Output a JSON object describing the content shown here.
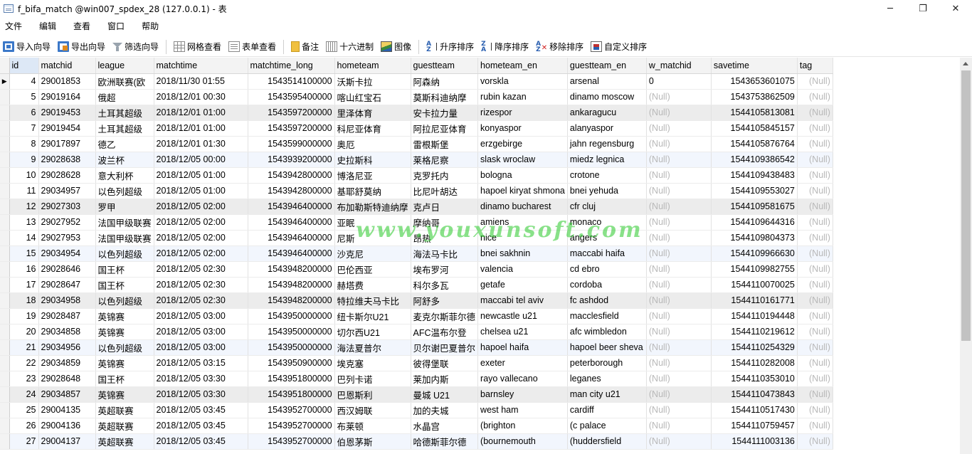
{
  "window": {
    "title": "f_bifa_match @win007_spdex_28 (127.0.0.1) - 表",
    "minimize": "─",
    "restore": "❐",
    "close": "✕"
  },
  "menu": [
    "文件",
    "编辑",
    "查看",
    "窗口",
    "帮助"
  ],
  "toolbar": {
    "import": "导入向导",
    "export": "导出向导",
    "filter": "筛选向导",
    "grid_view": "网格查看",
    "form_view": "表单查看",
    "memo": "备注",
    "hex": "十六进制",
    "image": "图像",
    "sort_asc": "升序排序",
    "sort_desc": "降序排序",
    "remove_sort": "移除排序",
    "custom_sort": "自定义排序"
  },
  "grid": {
    "columns": [
      "id",
      "matchid",
      "league",
      "matchtime",
      "matchtime_long",
      "hometeam",
      "guestteam",
      "hometeam_en",
      "guestteam_en",
      "w_matchid",
      "savetime",
      "tag"
    ],
    "null_text": "(Null)",
    "rows": [
      [
        "4",
        "29001853",
        "欧洲联赛(欧",
        "2018/11/30 01:55",
        "1543514100000",
        "沃斯卡拉",
        "阿森纳",
        "vorskla",
        "arsenal",
        "0",
        "1543653601075",
        "(Null)"
      ],
      [
        "5",
        "29019164",
        "俄超",
        "2018/12/01 00:30",
        "1543595400000",
        "喀山红宝石",
        "莫斯科迪纳摩",
        "rubin kazan",
        "dinamo moscow",
        "(Null)",
        "1543753862509",
        "(Null)"
      ],
      [
        "6",
        "29019453",
        "土耳其超级",
        "2018/12/01 01:00",
        "1543597200000",
        "里泽体育",
        "安卡拉力量",
        "rizespor",
        "ankaragucu",
        "(Null)",
        "1544105813081",
        "(Null)"
      ],
      [
        "7",
        "29019454",
        "土耳其超级",
        "2018/12/01 01:00",
        "1543597200000",
        "科尼亚体育",
        "阿拉尼亚体育",
        "konyaspor",
        "alanyaspor",
        "(Null)",
        "1544105845157",
        "(Null)"
      ],
      [
        "8",
        "29017897",
        "德乙",
        "2018/12/01 01:30",
        "1543599000000",
        "奥厄",
        "雷根斯堡",
        "erzgebirge",
        "jahn regensburg",
        "(Null)",
        "1544105876764",
        "(Null)"
      ],
      [
        "9",
        "29028638",
        "波兰杯",
        "2018/12/05 00:00",
        "1543939200000",
        "史拉斯科",
        "莱格尼察",
        "slask wroclaw",
        "miedz legnica",
        "(Null)",
        "1544109386542",
        "(Null)"
      ],
      [
        "10",
        "29028628",
        "意大利杯",
        "2018/12/05 01:00",
        "1543942800000",
        "博洛尼亚",
        "克罗托内",
        "bologna",
        "crotone",
        "(Null)",
        "1544109438483",
        "(Null)"
      ],
      [
        "11",
        "29034957",
        "以色列超级",
        "2018/12/05 01:00",
        "1543942800000",
        "基耶舒莫纳",
        "比尼叶胡达",
        "hapoel kiryat shmona",
        "bnei yehuda",
        "(Null)",
        "1544109553027",
        "(Null)"
      ],
      [
        "12",
        "29027303",
        "罗甲",
        "2018/12/05 02:00",
        "1543946400000",
        "布加勒斯特迪纳摩",
        "克卢日",
        "dinamo bucharest",
        "cfr cluj",
        "(Null)",
        "1544109581675",
        "(Null)"
      ],
      [
        "13",
        "29027952",
        "法国甲级联赛",
        "2018/12/05 02:00",
        "1543946400000",
        "亚眠",
        "摩纳哥",
        "amiens",
        "monaco",
        "(Null)",
        "1544109644316",
        "(Null)"
      ],
      [
        "14",
        "29027953",
        "法国甲级联赛",
        "2018/12/05 02:00",
        "1543946400000",
        "尼斯",
        "昂热",
        "nice",
        "angers",
        "(Null)",
        "1544109804373",
        "(Null)"
      ],
      [
        "15",
        "29034954",
        "以色列超级",
        "2018/12/05 02:00",
        "1543946400000",
        "沙克尼",
        "海法马卡比",
        "bnei sakhnin",
        "maccabi haifa",
        "(Null)",
        "1544109966630",
        "(Null)"
      ],
      [
        "16",
        "29028646",
        "国王杯",
        "2018/12/05 02:30",
        "1543948200000",
        "巴伦西亚",
        "埃布罗河",
        "valencia",
        "cd ebro",
        "(Null)",
        "1544109982755",
        "(Null)"
      ],
      [
        "17",
        "29028647",
        "国王杯",
        "2018/12/05 02:30",
        "1543948200000",
        "赫塔费",
        "科尔多瓦",
        "getafe",
        "cordoba",
        "(Null)",
        "1544110070025",
        "(Null)"
      ],
      [
        "18",
        "29034958",
        "以色列超级",
        "2018/12/05 02:30",
        "1543948200000",
        "特拉维夫马卡比",
        "阿舒多",
        "maccabi tel aviv",
        "fc ashdod",
        "(Null)",
        "1544110161771",
        "(Null)"
      ],
      [
        "19",
        "29028487",
        "英锦赛",
        "2018/12/05 03:00",
        "1543950000000",
        "纽卡斯尔U21",
        "麦克尔斯菲尔德",
        "newcastle u21",
        "macclesfield",
        "(Null)",
        "1544110194448",
        "(Null)"
      ],
      [
        "20",
        "29034858",
        "英锦赛",
        "2018/12/05 03:00",
        "1543950000000",
        "切尔西U21",
        "AFC温布尔登",
        "chelsea u21",
        "afc wimbledon",
        "(Null)",
        "1544110219612",
        "(Null)"
      ],
      [
        "21",
        "29034956",
        "以色列超级",
        "2018/12/05 03:00",
        "1543950000000",
        "海法夏普尔",
        "贝尔谢巴夏普尔",
        "hapoel haifa",
        "hapoel beer sheva",
        "(Null)",
        "1544110254329",
        "(Null)"
      ],
      [
        "22",
        "29034859",
        "英锦赛",
        "2018/12/05 03:15",
        "1543950900000",
        "埃克塞",
        "彼得堡联",
        "exeter",
        "peterborough",
        "(Null)",
        "1544110282008",
        "(Null)"
      ],
      [
        "23",
        "29028648",
        "国王杯",
        "2018/12/05 03:30",
        "1543951800000",
        "巴列卡诺",
        "莱加内斯",
        "rayo vallecano",
        "leganes",
        "(Null)",
        "1544110353010",
        "(Null)"
      ],
      [
        "24",
        "29034857",
        "英锦赛",
        "2018/12/05 03:30",
        "1543951800000",
        "巴恩斯利",
        "曼城 U21",
        "barnsley",
        "man city u21",
        "(Null)",
        "1544110473843",
        "(Null)"
      ],
      [
        "25",
        "29004135",
        "英超联赛",
        "2018/12/05 03:45",
        "1543952700000",
        "西汉姆联",
        "加的夫城",
        "west ham",
        "cardiff",
        "(Null)",
        "1544110517430",
        "(Null)"
      ],
      [
        "26",
        "29004136",
        "英超联赛",
        "2018/12/05 03:45",
        "1543952700000",
        "布莱顿",
        "水晶宫",
        "(brighton",
        "(c palace",
        "(Null)",
        "1544110759457",
        "(Null)"
      ],
      [
        "27",
        "29004137",
        "英超联赛",
        "2018/12/05 03:45",
        "1543952700000",
        "伯恩茅斯",
        "哈德斯菲尔德",
        "(bournemouth",
        "(huddersfield",
        "(Null)",
        "1544111003136",
        "(Null)"
      ]
    ],
    "row_styles": [
      "odd",
      "odd",
      "even",
      "odd",
      "odd",
      "hilite",
      "odd",
      "odd",
      "even",
      "odd",
      "odd",
      "hilite",
      "odd",
      "odd",
      "even",
      "odd",
      "odd",
      "hilite",
      "odd",
      "odd",
      "even",
      "odd",
      "odd",
      "hilite"
    ],
    "current_row_marker": "▶"
  },
  "watermark": "www.youxunsoft.com"
}
